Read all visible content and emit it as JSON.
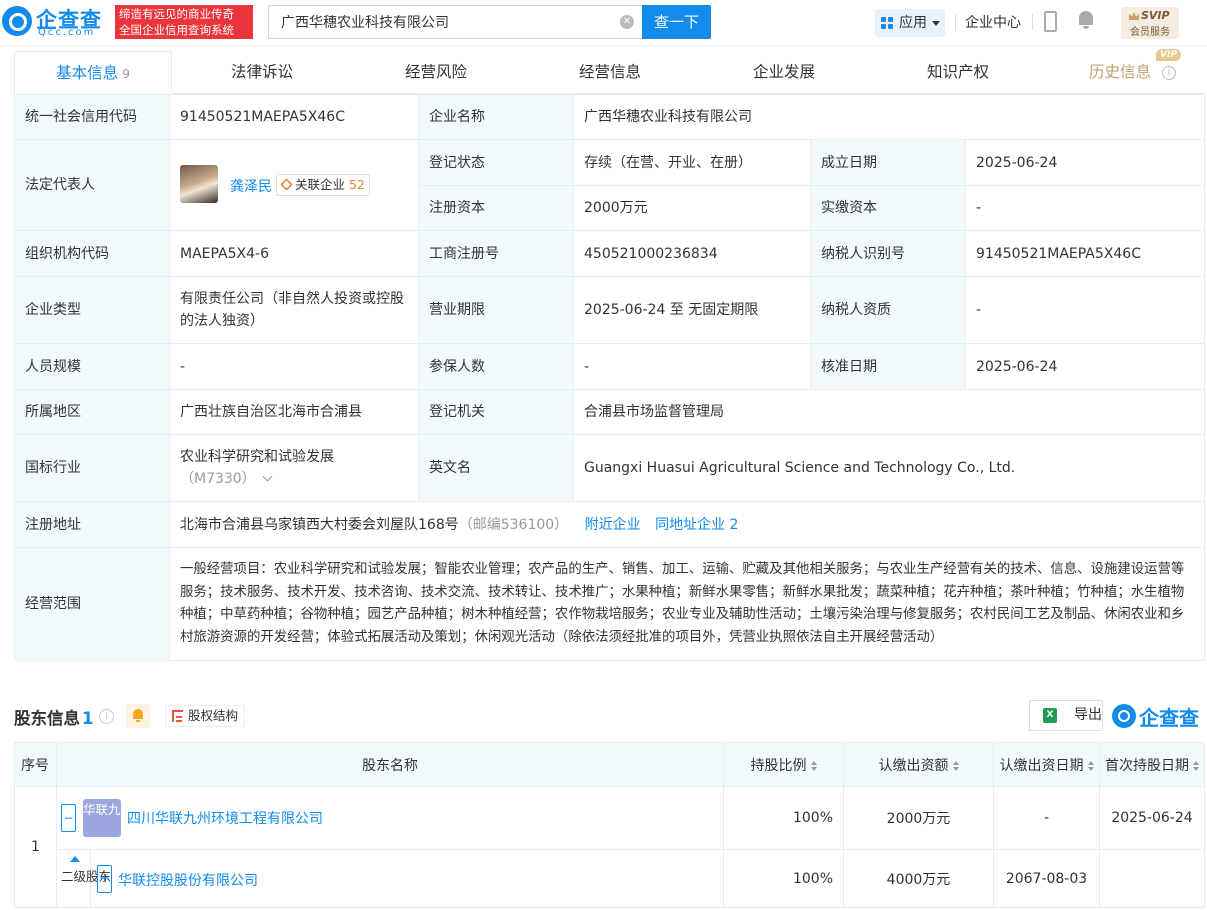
{
  "header": {
    "logo_cn": "企查查",
    "logo_en": "Qcc.com",
    "slogan_line1": "缔造有远见的商业传奇",
    "slogan_line2": "全国企业信用查询系统",
    "search_value": "广西华穗农业科技有限公司",
    "search_button": "查一下",
    "apps_label": "应用",
    "enterprise_center": "企业中心",
    "svip_title": "SVIP",
    "svip_sub": "会员服务"
  },
  "tabs": [
    {
      "label": "基本信息",
      "count": "9"
    },
    {
      "label": "法律诉讼"
    },
    {
      "label": "经营风险"
    },
    {
      "label": "经营信息"
    },
    {
      "label": "企业发展"
    },
    {
      "label": "知识产权"
    },
    {
      "label": "历史信息",
      "badge": "VIP"
    }
  ],
  "basic": {
    "credit_code_label": "统一社会信用代码",
    "credit_code": "91450521MAEPA5X46C",
    "company_name_label": "企业名称",
    "company_name": "广西华穗农业科技有限公司",
    "legal_rep_label": "法定代表人",
    "legal_rep_name": "龚泽民",
    "related_label": "关联企业",
    "related_count": "52",
    "reg_status_label": "登记状态",
    "reg_status": "存续（在营、开业、在册）",
    "founded_label": "成立日期",
    "founded": "2025-06-24",
    "reg_capital_label": "注册资本",
    "reg_capital": "2000万元",
    "paid_capital_label": "实缴资本",
    "paid_capital": "-",
    "org_code_label": "组织机构代码",
    "org_code": "MAEPA5X4-6",
    "biz_reg_no_label": "工商注册号",
    "biz_reg_no": "450521000236834",
    "taxpayer_id_label": "纳税人识别号",
    "taxpayer_id": "91450521MAEPA5X46C",
    "company_type_label": "企业类型",
    "company_type": "有限责任公司（非自然人投资或控股的法人独资）",
    "biz_term_label": "营业期限",
    "biz_term": "2025-06-24 至 无固定期限",
    "taxpayer_qual_label": "纳税人资质",
    "taxpayer_qual": "-",
    "staff_size_label": "人员规模",
    "staff_size": "-",
    "insured_label": "参保人数",
    "insured": "-",
    "approve_date_label": "核准日期",
    "approve_date": "2025-06-24",
    "region_label": "所属地区",
    "region": "广西壮族自治区北海市合浦县",
    "authority_label": "登记机关",
    "authority": "合浦县市场监督管理局",
    "industry_label": "国标行业",
    "industry": "农业科学研究和试验发展",
    "industry_code": "（M7330）",
    "english_name_label": "英文名",
    "english_name": "Guangxi Huasui Agricultural Science and Technology Co., Ltd.",
    "address_label": "注册地址",
    "address": "北海市合浦县乌家镇西大村委会刘屋队168号",
    "postcode": "（邮编536100）",
    "nearby_link": "附近企业",
    "same_addr_link": "同地址企业 2",
    "scope_label": "经营范围",
    "scope": "一般经营项目：农业科学研究和试验发展；智能农业管理；农产品的生产、销售、加工、运输、贮藏及其他相关服务；与农业生产经营有关的技术、信息、设施建设运营等服务；技术服务、技术开发、技术咨询、技术交流、技术转让、技术推广；水果种植；新鲜水果零售；新鲜水果批发；蔬菜种植；花卉种植；茶叶种植；竹种植；水生植物种植；中草药种植；谷物种植；园艺产品种植；树木种植经营；农作物栽培服务；农业专业及辅助性活动；土壤污染治理与修复服务；农村民间工艺及制品、休闲农业和乡村旅游资源的开发经营；体验式拓展活动及策划；休闲观光活动（除依法须经批准的项目外，凭营业执照依法自主开展经营活动）"
  },
  "shareholders": {
    "title": "股东信息",
    "count": "1",
    "equity_label": "股权结构",
    "export_label": "导出",
    "watermark": "企查查",
    "columns": [
      "序号",
      "股东名称",
      "持股比例",
      "认缴出资额",
      "认缴出资日期",
      "首次持股日期"
    ],
    "rows": [
      {
        "index": "1",
        "logo_text": "华联九州",
        "name": "四川华联九州环境工程有限公司",
        "ratio": "100%",
        "subscribed": "2000万元",
        "subscribed_date": "-",
        "first_date": "2025-06-24"
      }
    ],
    "level2": {
      "label": "二级股东",
      "name": "华联控股股份有限公司",
      "ratio": "100%",
      "subscribed": "4000万元",
      "subscribed_date": "2067-08-03",
      "first_date": ""
    }
  }
}
